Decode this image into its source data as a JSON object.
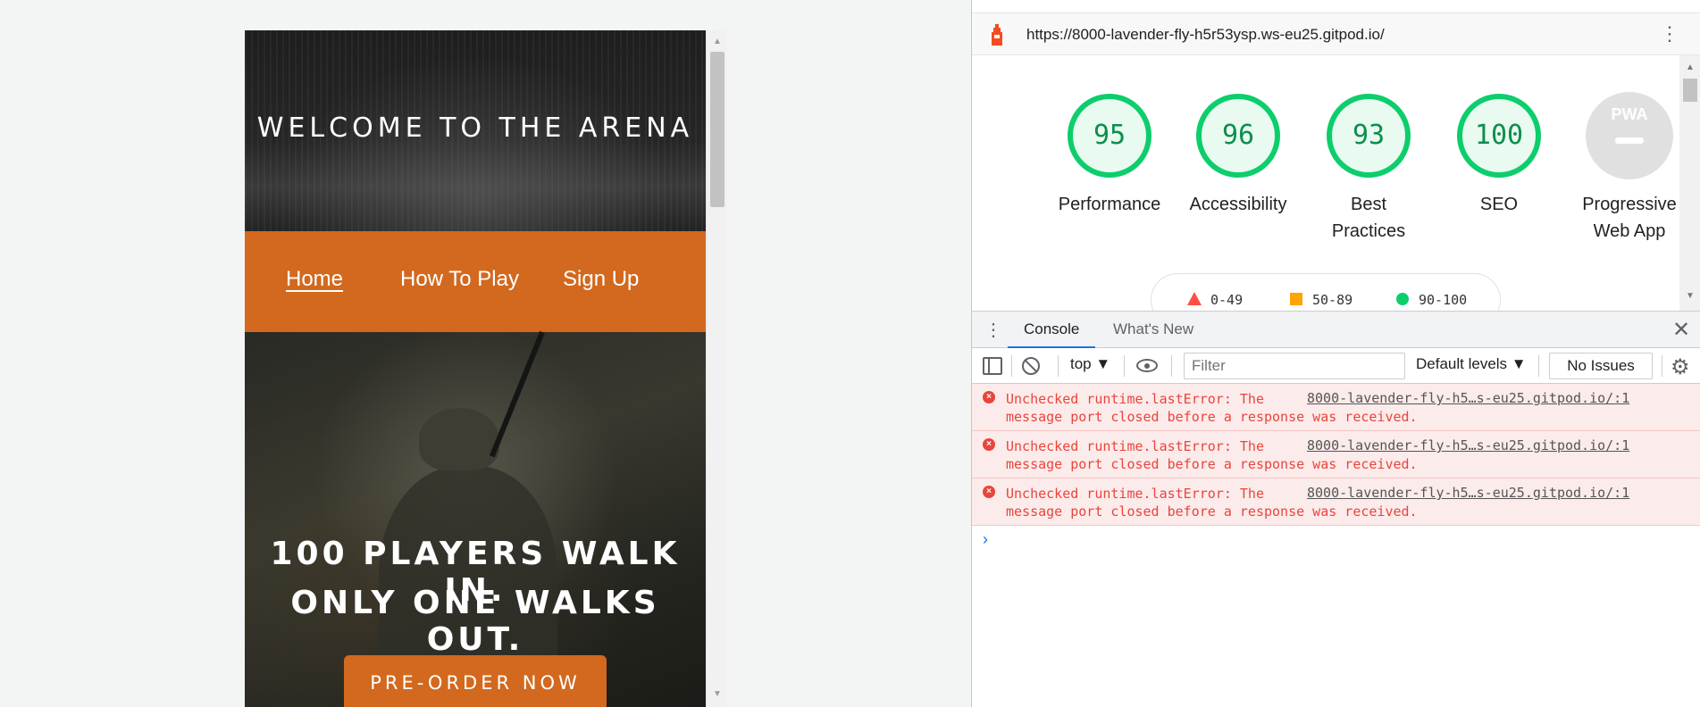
{
  "site": {
    "welcome": "WELCOME TO THE ARENA",
    "nav": [
      "Home",
      "How To Play",
      "Sign Up"
    ],
    "tagline_1": "100 PLAYERS WALK IN.",
    "tagline_2": "ONLY ONE WALKS OUT.",
    "cta": "PRE-ORDER NOW"
  },
  "lighthouse": {
    "url": "https://8000-lavender-fly-h5r53ysp.ws-eu25.gitpod.io/",
    "scores": [
      {
        "label": "Performance",
        "value": 95
      },
      {
        "label": "Accessibility",
        "value": 96
      },
      {
        "label_1": "Best",
        "label_2": "Practices",
        "value": 93
      },
      {
        "label": "SEO",
        "value": 100
      },
      {
        "label_1": "Progressive",
        "label_2": "Web App",
        "value": null,
        "badge": "PWA"
      }
    ],
    "legend": {
      "fail": "0-49",
      "average": "50-89",
      "pass": "90-100"
    },
    "colors": {
      "pass": "#0cce6b",
      "average": "#ffa400",
      "fail": "#ff4e42",
      "na": "#e0e0e0"
    }
  },
  "devtools": {
    "tabs": [
      "Console",
      "What's New"
    ],
    "context": "top",
    "filter_placeholder": "Filter",
    "levels": "Default levels",
    "issues": "No Issues",
    "errors": [
      {
        "line1": "Unchecked runtime.lastError: The",
        "line2": "message port closed before a response was received.",
        "source": "8000-lavender-fly-h5…s-eu25.gitpod.io/:1"
      },
      {
        "line1": "Unchecked runtime.lastError: The",
        "line2": "message port closed before a response was received.",
        "source": "8000-lavender-fly-h5…s-eu25.gitpod.io/:1"
      },
      {
        "line1": "Unchecked runtime.lastError: The",
        "line2": "message port closed before a response was received.",
        "source": "8000-lavender-fly-h5…s-eu25.gitpod.io/:1"
      }
    ],
    "prompt": "›"
  }
}
